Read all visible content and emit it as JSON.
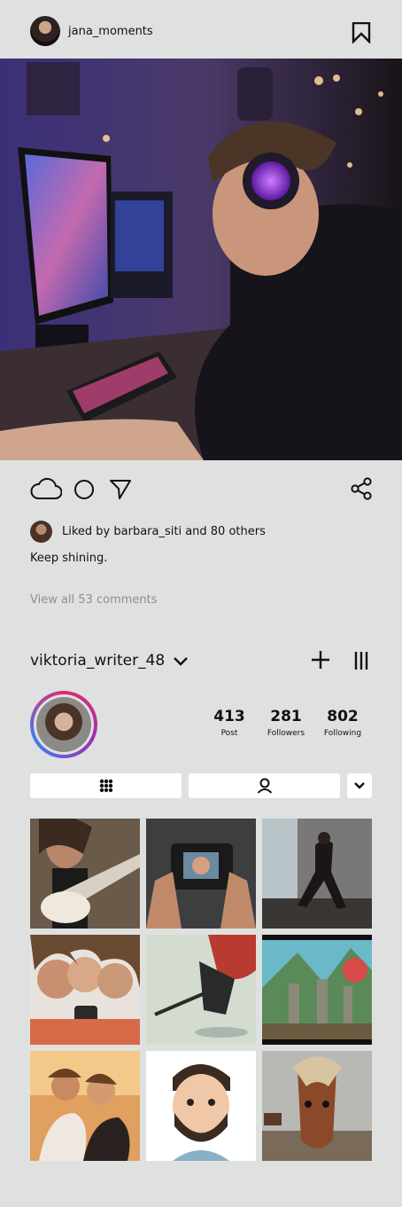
{
  "post": {
    "username": "jana_moments",
    "liked_by": "Liked by barbara_siti and 80 others",
    "caption": "Keep shining.",
    "view_comments": "View all 53 comments"
  },
  "profile": {
    "username": "viktoria_writer_48",
    "stats": [
      {
        "value": "413",
        "label": "Post"
      },
      {
        "value": "281",
        "label": "Followers"
      },
      {
        "value": "802",
        "label": "Following"
      }
    ]
  },
  "icons": {
    "bookmark": "bookmark-icon",
    "comment": "cloud-icon",
    "like": "circle-icon",
    "send": "send-icon",
    "share": "share-icon",
    "dropdown": "chevron-down-icon",
    "add": "plus-icon",
    "menu": "menu-icon",
    "grid": "grid-icon",
    "tagged": "person-icon"
  },
  "grid": [
    {
      "subject": "woman playing guitar"
    },
    {
      "subject": "hands holding camera"
    },
    {
      "subject": "dancer in studio"
    },
    {
      "subject": "friends taking selfie"
    },
    {
      "subject": "hockey player illustration"
    },
    {
      "subject": "fantasy game landscape"
    },
    {
      "subject": "couple at sunset"
    },
    {
      "subject": "cartoon bearded man"
    },
    {
      "subject": "horse on beach"
    }
  ]
}
